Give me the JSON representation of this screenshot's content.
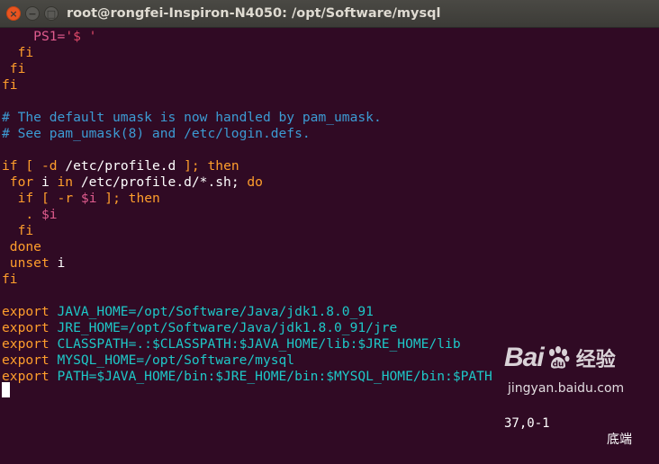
{
  "window": {
    "title": "root@rongfei-Inspiron-N4050: /opt/Software/mysql",
    "close_symbol": "×",
    "minimize_symbol": "−",
    "maximize_symbol": "□"
  },
  "colors": {
    "background": "#300a24",
    "text": "#ffffff",
    "keyword": "#ff9e2c",
    "comment": "#3c9bd3",
    "string": "#e04a6a",
    "variable": "#e05c8e",
    "export_value": "#1ec8c8"
  },
  "editor": {
    "lines": [
      [
        {
          "t": "    "
        },
        {
          "t": "PS1=",
          "c": "var"
        },
        {
          "t": "'$ '",
          "c": "str"
        }
      ],
      [
        {
          "t": "  "
        },
        {
          "t": "fi",
          "c": "kw"
        }
      ],
      [
        {
          "t": " "
        },
        {
          "t": "fi",
          "c": "kw"
        }
      ],
      [
        {
          "t": "fi",
          "c": "kw"
        }
      ],
      [],
      [
        {
          "t": "# The default umask is now handled by pam_umask.",
          "c": "cm"
        }
      ],
      [
        {
          "t": "# See pam_umask(8) and /etc/login.defs.",
          "c": "cm"
        }
      ],
      [],
      [
        {
          "t": "if",
          "c": "kw"
        },
        {
          "t": " "
        },
        {
          "t": "[",
          "c": "kw"
        },
        {
          "t": " "
        },
        {
          "t": "-d",
          "c": "kw"
        },
        {
          "t": " /etc/profile.d "
        },
        {
          "t": "];",
          "c": "kw"
        },
        {
          "t": " "
        },
        {
          "t": "then",
          "c": "kw"
        }
      ],
      [
        {
          "t": " "
        },
        {
          "t": "for",
          "c": "kw"
        },
        {
          "t": " i "
        },
        {
          "t": "in",
          "c": "kw"
        },
        {
          "t": " /etc/profile.d/*.sh; "
        },
        {
          "t": "do",
          "c": "kw"
        }
      ],
      [
        {
          "t": "  "
        },
        {
          "t": "if",
          "c": "kw"
        },
        {
          "t": " "
        },
        {
          "t": "[",
          "c": "kw"
        },
        {
          "t": " "
        },
        {
          "t": "-r",
          "c": "kw"
        },
        {
          "t": " "
        },
        {
          "t": "$i",
          "c": "var"
        },
        {
          "t": " "
        },
        {
          "t": "];",
          "c": "kw"
        },
        {
          "t": " "
        },
        {
          "t": "then",
          "c": "kw"
        }
      ],
      [
        {
          "t": "   "
        },
        {
          "t": ".",
          "c": "kw"
        },
        {
          "t": " "
        },
        {
          "t": "$i",
          "c": "var"
        }
      ],
      [
        {
          "t": "  "
        },
        {
          "t": "fi",
          "c": "kw"
        }
      ],
      [
        {
          "t": " "
        },
        {
          "t": "done",
          "c": "kw"
        }
      ],
      [
        {
          "t": " "
        },
        {
          "t": "unset",
          "c": "kw"
        },
        {
          "t": " i"
        }
      ],
      [
        {
          "t": "fi",
          "c": "kw"
        }
      ],
      [],
      [
        {
          "t": "export",
          "c": "kw"
        },
        {
          "t": " JAVA_HOME=/opt/Software/Java/jdk1.8.0_91",
          "c": "ex"
        }
      ],
      [
        {
          "t": "export",
          "c": "kw"
        },
        {
          "t": " JRE_HOME=/opt/Software/Java/jdk1.8.0_91/jre",
          "c": "ex"
        }
      ],
      [
        {
          "t": "export",
          "c": "kw"
        },
        {
          "t": " CLASSPATH=.:$CLASSPATH:$JAVA_HOME/lib:$JRE_HOME/lib",
          "c": "ex"
        }
      ],
      [
        {
          "t": "export",
          "c": "kw"
        },
        {
          "t": " MYSQL_HOME=/opt/Software/mysql",
          "c": "ex"
        }
      ],
      [
        {
          "t": "export",
          "c": "kw"
        },
        {
          "t": " PATH=$JAVA_HOME/bin:$JRE_HOME/bin:$MYSQL_HOME/bin:$PATH",
          "c": "ex"
        }
      ]
    ]
  },
  "status": {
    "position": "37,0-1",
    "scroll": "底端"
  },
  "watermark": {
    "logo_left": "Bai",
    "logo_right": "经验",
    "url": "jingyan.baidu.com"
  }
}
